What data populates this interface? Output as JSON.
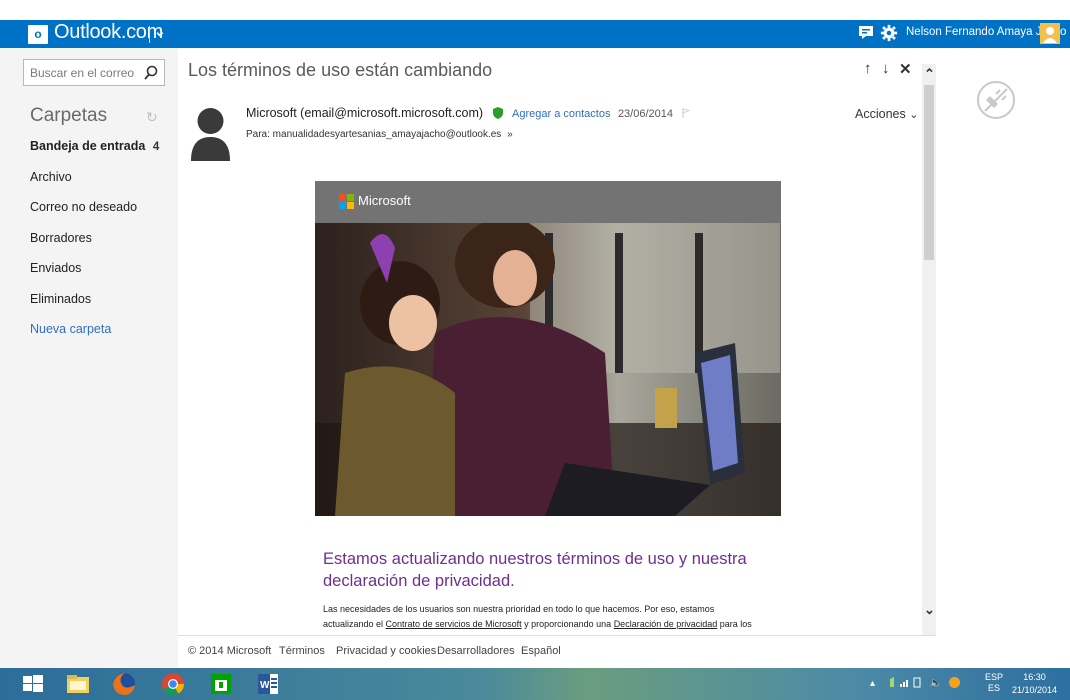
{
  "header": {
    "logo_mark": "o",
    "app_title": "Outlook.com",
    "user_name": "Nelson Fernando Amaya Jacho",
    "brand_color": "#0072c6"
  },
  "sidebar": {
    "search_placeholder": "Buscar en el correo",
    "folders_title": "Carpetas",
    "items": [
      {
        "label": "Bandeja de entrada",
        "count": "4",
        "active": true
      },
      {
        "label": "Archivo"
      },
      {
        "label": "Correo no deseado"
      },
      {
        "label": "Borradores"
      },
      {
        "label": "Enviados"
      },
      {
        "label": "Eliminados"
      },
      {
        "label": "Nueva carpeta",
        "link": true
      }
    ]
  },
  "message": {
    "subject": "Los términos de uso están cambiando",
    "sender": "Microsoft (email@microsoft.microsoft.com)",
    "add_to_contacts": "Agregar a contactos",
    "date": "23/06/2014",
    "to": "Para: manualidadesyartesanias_amayajacho@outlook.es",
    "to_chevron": "»",
    "actions_label": "Acciones",
    "actions_chevron": "⌄"
  },
  "email_body": {
    "banner_brand": "Microsoft",
    "headline": "Estamos actualizando nuestros términos de uso y nuestra declaración de privacidad.",
    "paragraph_start": "Las necesidades de los usuarios son nuestra prioridad en todo lo que hacemos. Por eso, estamos actualizando el ",
    "link_contract": "Contrato de servicios de Microsoft",
    "paragraph_mid": " y proporcionando una ",
    "link_privacy": "Declaración de privacidad",
    "paragraph_end": " para los servicios de"
  },
  "footer": {
    "copyright": "© 2014 Microsoft",
    "terms": "Términos",
    "privacy": "Privacidad y cookies",
    "developers": "Desarrolladores",
    "language": "Español"
  },
  "taskbar": {
    "lang_top": "ESP",
    "lang_bottom": "ES",
    "time": "16:30",
    "date": "21/10/2014"
  }
}
